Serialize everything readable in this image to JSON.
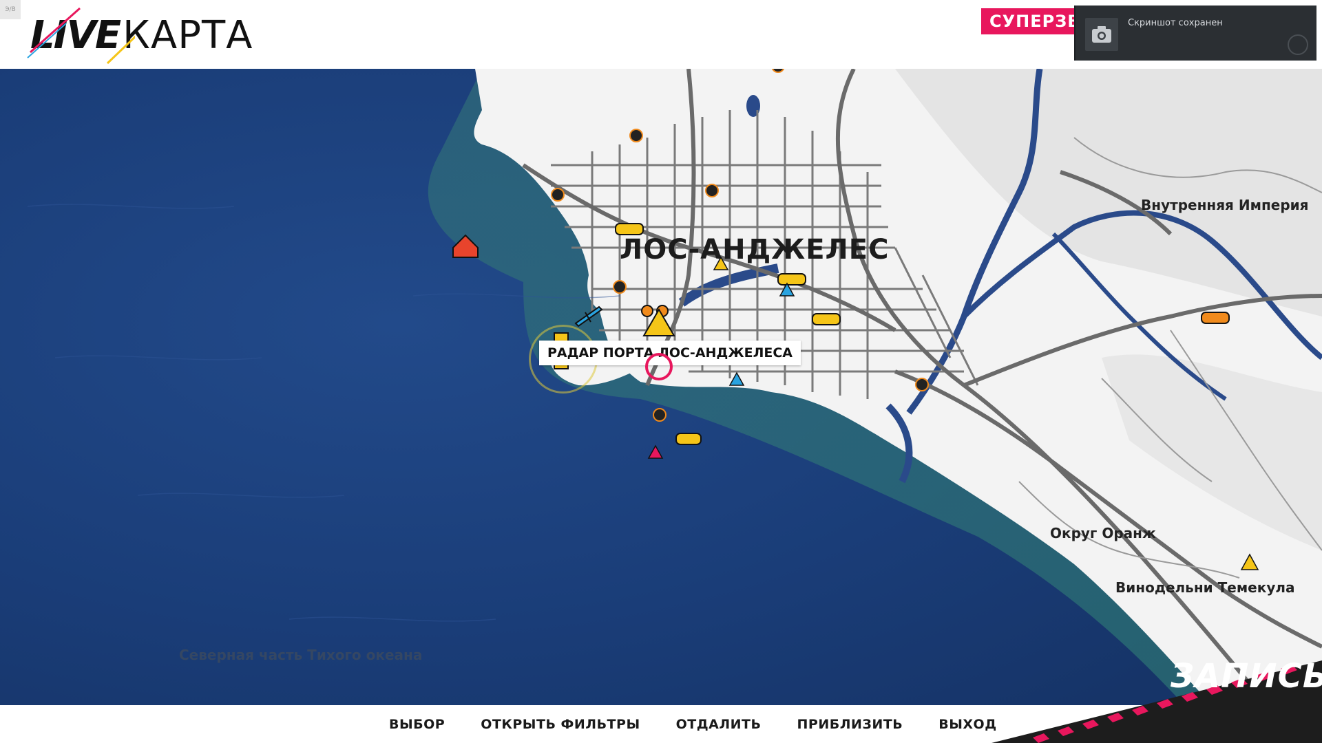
{
  "header": {
    "logo_live": "LIVE",
    "logo_title": "КАРТА",
    "supervideo_label": "СУПЕРЗВЕ",
    "corner_badge": "Э/В"
  },
  "toast": {
    "message": "Скриншот сохранен",
    "icon": "camera-icon"
  },
  "map": {
    "city_label": "ЛОС-АНДЖЕЛЕС",
    "regions": {
      "inland_empire": "Внутренняя Империя",
      "orange_county": "Округ Оранж",
      "temecula": "Винодельни Темекула",
      "ocean": "Северная часть Тихого океана"
    },
    "tooltip": "РАДАР ПОРТА ЛОС-АНДЖЕЛЕСА",
    "colors": {
      "ocean": "#1a3d78",
      "land": "#f2f2f2",
      "road": "#707070",
      "water": "#2a4a8a",
      "accent": "#e8175d",
      "marker_yellow": "#f5c518",
      "marker_orange": "#f08a1c",
      "marker_blue": "#29a3e0"
    }
  },
  "bottom_bar": {
    "actions": [
      "ВЫБОР",
      "ОТКРЫТЬ ФИЛЬТРЫ",
      "ОТДАЛИТЬ",
      "ПРИБЛИЗИТЬ",
      "ВЫХОД"
    ],
    "record_label": "ЗАПИСЬ"
  }
}
